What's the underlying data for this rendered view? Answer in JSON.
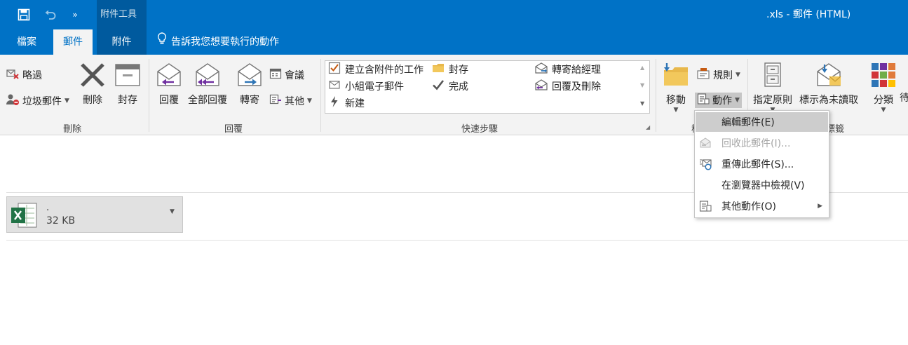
{
  "titlebar": {
    "context_tab_group": "附件工具",
    "window_title": ".xls  -  郵件 (HTML)",
    "icons": [
      "save-icon",
      "undo-icon",
      "qat-more-icon"
    ]
  },
  "tabs": [
    {
      "label": "檔案",
      "active": false
    },
    {
      "label": "郵件",
      "active": true
    },
    {
      "label": "附件",
      "active": false
    }
  ],
  "tell_me": "告訴我您想要執行的動作",
  "ribbon": {
    "delete_group": {
      "label": "刪除",
      "ignore": "略過",
      "junk": "垃圾郵件",
      "delete": "刪除",
      "archive": "封存"
    },
    "respond_group": {
      "label": "回覆",
      "reply": "回覆",
      "reply_all": "全部回覆",
      "forward": "轉寄",
      "meeting": "會議",
      "more": "其他"
    },
    "quick_steps": {
      "label": "快速步驟",
      "items": [
        {
          "label": "建立含附件的工作",
          "icon": "task-check-icon"
        },
        {
          "label": "封存",
          "icon": "archive-folder-icon"
        },
        {
          "label": "轉寄給經理",
          "icon": "forward-manager-icon"
        },
        {
          "label": "小組電子郵件",
          "icon": "team-email-icon"
        },
        {
          "label": "完成",
          "icon": "checkmark-icon"
        },
        {
          "label": "回覆及刪除",
          "icon": "reply-delete-icon"
        },
        {
          "label": "新建",
          "icon": "lightning-icon"
        }
      ]
    },
    "move_group": {
      "move": "移動",
      "rules": "規則",
      "actions": "動作"
    },
    "tags_group": {
      "assign_policy": "指定原則",
      "mark_unread": "標示為未讀取",
      "categorize": "分類",
      "followup_partial": "待"
    },
    "hidden_labels": {
      "move_group_partial": "移",
      "tags_partial": "標籤"
    }
  },
  "attachment": {
    "name": ".",
    "size": "32 KB"
  },
  "actions_menu": {
    "items": [
      {
        "label": "編輯郵件(E)",
        "highlighted": true,
        "disabled": false,
        "icon": ""
      },
      {
        "label": "回收此郵件(I)...",
        "highlighted": false,
        "disabled": true,
        "icon": "recall-icon"
      },
      {
        "label": "重傳此郵件(S)...",
        "highlighted": false,
        "disabled": false,
        "icon": "resend-icon"
      },
      {
        "label": "在瀏覽器中檢視(V)",
        "highlighted": false,
        "disabled": false,
        "icon": ""
      },
      {
        "label": "其他動作(O)",
        "highlighted": false,
        "disabled": false,
        "icon": "other-actions-icon",
        "submenu": true
      }
    ]
  },
  "colors": {
    "titlebar": "#0072c6",
    "context_group": "#005a9e",
    "ribbon_bg": "#f3f3f3",
    "menu_highlight": "#cdcdcd",
    "attachment_bg": "#e1e1e1"
  }
}
